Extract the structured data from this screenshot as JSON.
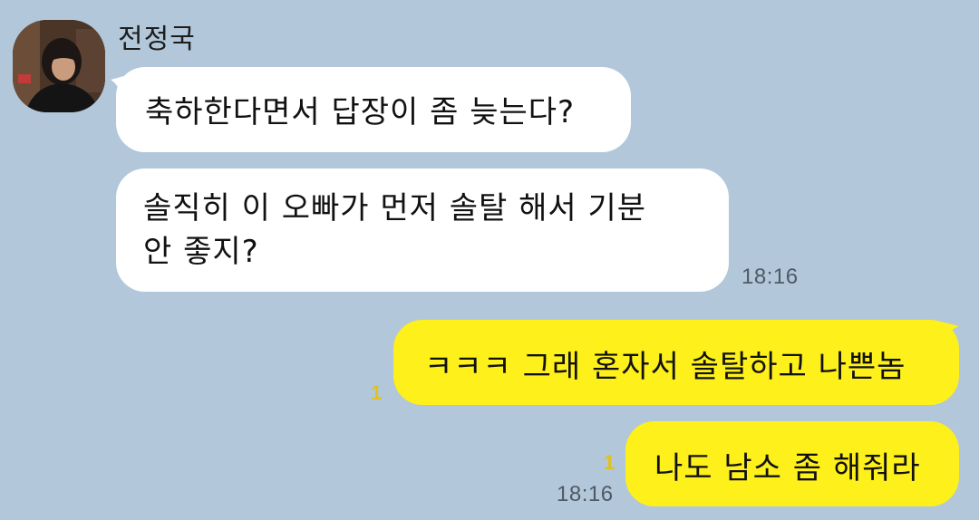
{
  "chat": {
    "sender": "전정국",
    "messages": [
      {
        "direction": "in",
        "text": "축하한다면서 답장이 좀 늦는다?"
      },
      {
        "direction": "in",
        "lines": [
          "솔직히 이 오빠가 먼저 솔탈 해서 기분",
          "안 좋지?"
        ],
        "time": "18:16"
      },
      {
        "direction": "out",
        "text": "ㅋㅋㅋ 그래 혼자서 솔탈하고 나쁜놈",
        "unread": "1"
      },
      {
        "direction": "out",
        "text": "나도 남소 좀 해줘라",
        "unread": "1",
        "time": "18:16"
      }
    ]
  },
  "colors": {
    "background": "#b2c7d9",
    "incoming_bubble": "#ffffff",
    "outgoing_bubble": "#fef01b",
    "unread_badge": "#e0c21b"
  },
  "icons": {
    "avatar": "profile-photo"
  }
}
